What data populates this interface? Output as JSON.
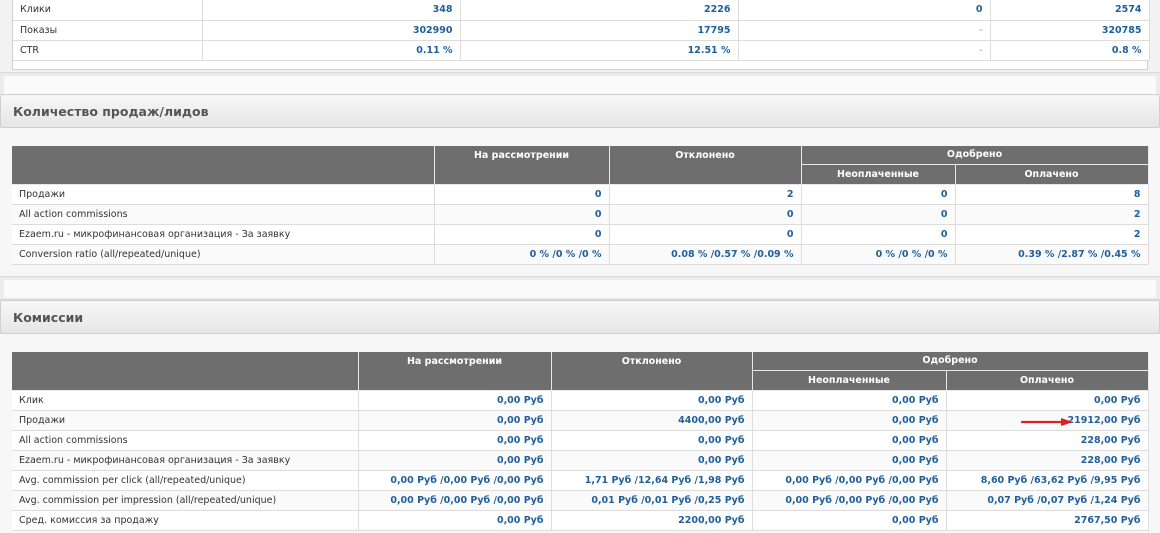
{
  "traffic": {
    "rows": [
      {
        "label": "Клики",
        "values": [
          "348",
          "2226",
          "0",
          "2574"
        ]
      },
      {
        "label": "Показы",
        "values": [
          "302990",
          "17795",
          "-",
          "320785"
        ]
      },
      {
        "label": "CTR",
        "values": [
          "0.11 %",
          "12.51 %",
          "-",
          "0.8 %"
        ]
      }
    ]
  },
  "sales": {
    "title": "Количество продаж/лидов",
    "headers": {
      "pending": "На рассмотрении",
      "declined": "Отклонено",
      "approved": "Одобрено",
      "unpaid": "Неоплаченные",
      "paid": "Оплачено"
    },
    "rows": [
      {
        "label": "Продажи",
        "values": [
          "0",
          "2",
          "0",
          "8"
        ]
      },
      {
        "label": "All action commissions",
        "values": [
          "0",
          "0",
          "0",
          "2"
        ]
      },
      {
        "label": "Ezaem.ru - микрофинансовая организация - За заявку",
        "values": [
          "0",
          "0",
          "0",
          "2"
        ]
      },
      {
        "label": "Conversion ratio (all/repeated/unique)",
        "values": [
          "0 % /0 % /0 %",
          "0.08 % /0.57 % /0.09 %",
          "0 % /0 % /0 %",
          "0.39 % /2.87 % /0.45 %"
        ]
      }
    ]
  },
  "commissions": {
    "title": "Комиссии",
    "headers": {
      "pending": "На рассмотрении",
      "declined": "Отклонено",
      "approved": "Одобрено",
      "unpaid": "Неоплаченные",
      "paid": "Оплачено"
    },
    "rows": [
      {
        "label": "Клик",
        "values": [
          "0,00 Руб",
          "0,00 Руб",
          "0,00 Руб",
          "0,00 Руб"
        ]
      },
      {
        "label": "Продажи",
        "values": [
          "0,00 Руб",
          "4400,00 Руб",
          "0,00 Руб",
          "21912,00 Руб"
        ]
      },
      {
        "label": "All action commissions",
        "values": [
          "0,00 Руб",
          "0,00 Руб",
          "0,00 Руб",
          "228,00 Руб"
        ]
      },
      {
        "label": "Ezaem.ru - микрофинансовая организация - За заявку",
        "values": [
          "0,00 Руб",
          "0,00 Руб",
          "0,00 Руб",
          "228,00 Руб"
        ]
      },
      {
        "label": "Avg. commission per click (all/repeated/unique)",
        "values": [
          "0,00 Руб /0,00 Руб /0,00 Руб",
          "1,71 Руб /12,64 Руб /1,98 Руб",
          "0,00 Руб /0,00 Руб /0,00 Руб",
          "8,60 Руб /63,62 Руб /9,95 Руб"
        ]
      },
      {
        "label": "Avg. commission per impression (all/repeated/unique)",
        "values": [
          "0,00 Руб /0,00 Руб /0,00 Руб",
          "0,01 Руб /0,01 Руб /0,25 Руб",
          "0,00 Руб /0,00 Руб /0,00 Руб",
          "0,07 Руб /0,07 Руб /1,24 Руб"
        ]
      },
      {
        "label": "Сред. комиссия за продажу",
        "values": [
          "0,00 Руб",
          "2200,00 Руб",
          "0,00 Руб",
          "2767,50 Руб"
        ]
      }
    ]
  },
  "annotation": {
    "arrow_color": "#e02020"
  }
}
